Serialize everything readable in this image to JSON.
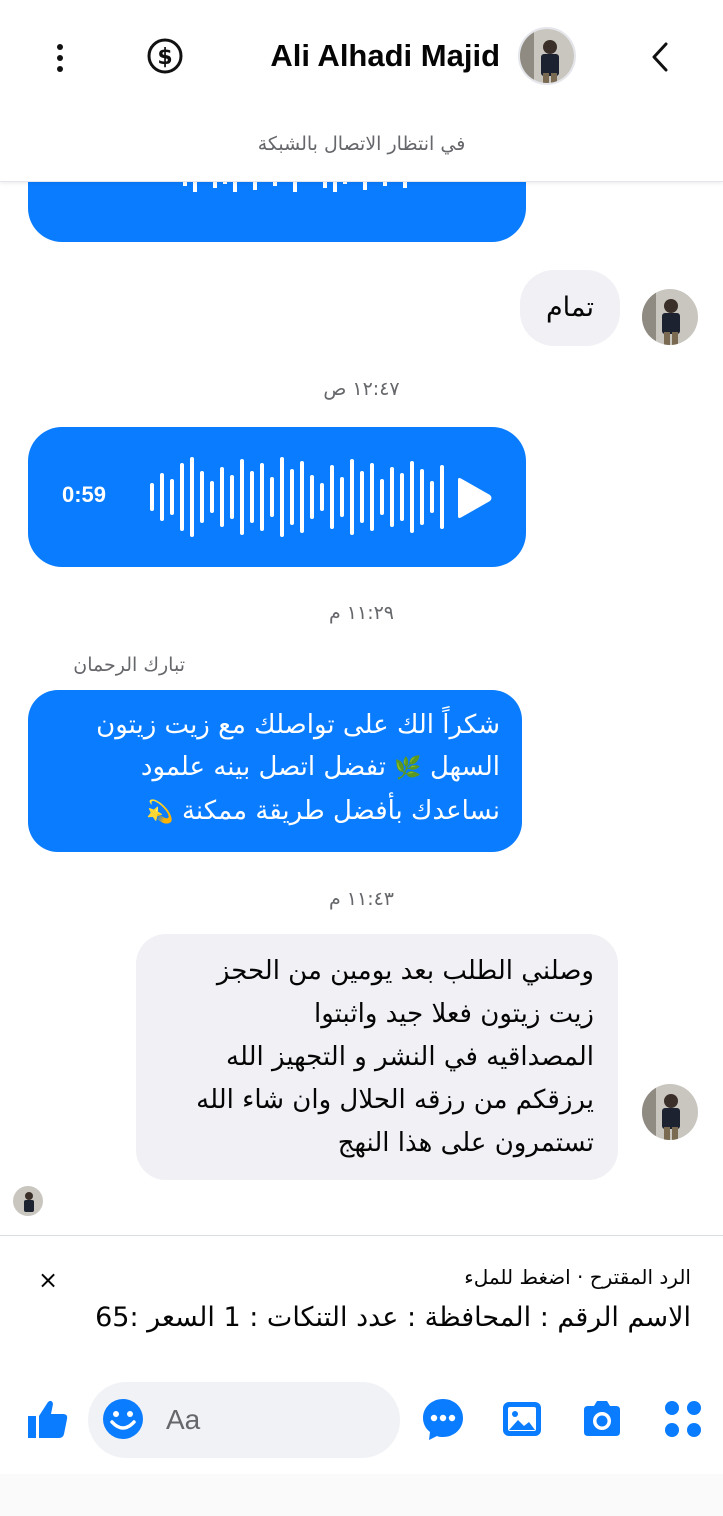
{
  "header": {
    "contact_name": "Ali Alhadi Majid",
    "status": "في انتظار الاتصال بالشبكة"
  },
  "messages": {
    "tamam": "تمام",
    "timestamp_1": "١٢:٤٧ ص",
    "voice_duration": "0:59",
    "timestamp_2": "١١:٢٩ م",
    "sender_label": "تبارك الرحمان",
    "reply_line_1": "شكراً الك على تواصلك مع زيت زيتون",
    "reply_line_2": "السهل",
    "reply_line_2b": "تفضل اتصل بينه علمود",
    "reply_line_3": "نساعدك بأفضل طريقة ممكنة",
    "emoji_herb": "🌿",
    "emoji_dizzy": "💫",
    "timestamp_3": "١١:٤٣ م",
    "customer_lines": [
      "وصلني الطلب بعد يومين من الحجز",
      "زيت زيتون فعلا جيد واثبتوا",
      "المصداقيه في النشر و التجهيز الله",
      "يرزقكم من رزقه الحلال وان شاء الله",
      "تستمرون على هذا النهج"
    ]
  },
  "suggested_reply": {
    "label": "الرد المقترح · اضغط للملء",
    "text": "الاسم الرقم : المحافظة : عدد التنكات : 1 السعر :65",
    "close_glyph": "×"
  },
  "composer": {
    "placeholder": "Aa"
  },
  "colors": {
    "accent": "#0a7cff",
    "gray_bubble": "#f0f0f5",
    "icon_blue": "#0a7cff"
  },
  "icons": [
    "more-vertical-icon",
    "dollar-icon",
    "back-chevron-icon",
    "play-icon",
    "like-icon",
    "emoji-icon",
    "chat-bubble-icon",
    "image-icon",
    "camera-icon",
    "apps-grid-icon",
    "close-icon"
  ]
}
